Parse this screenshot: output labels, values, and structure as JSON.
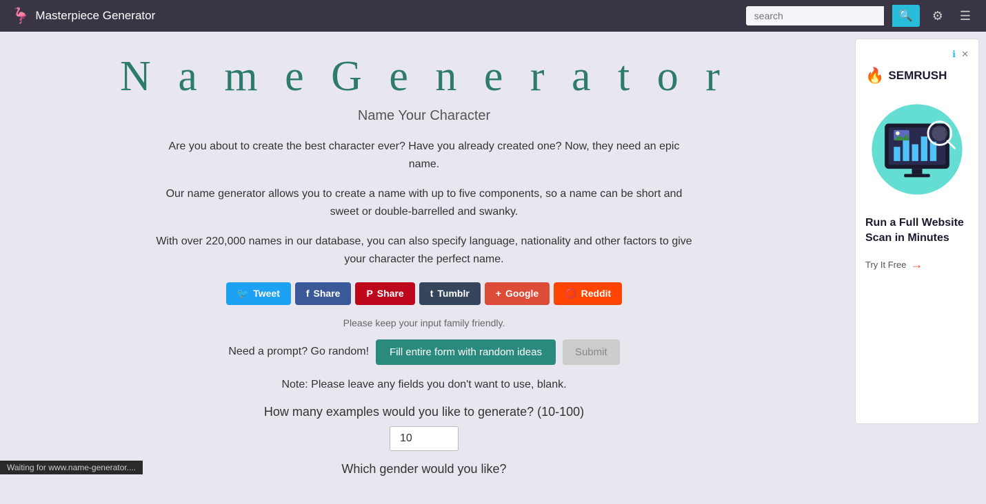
{
  "navbar": {
    "logo_icon": "🦩",
    "title": "Masterpiece Generator",
    "search_placeholder": "search",
    "search_icon": "🔍",
    "tune_icon": "⚙",
    "menu_icon": "☰"
  },
  "page": {
    "title": "N a m e   G e n e r a t o r",
    "subtitle": "Name Your Character",
    "description1": "Are you about to create the best character ever? Have you already created one? Now, they need an epic name.",
    "description2": "Our name generator allows you to create a name with up to five components, so a name can be short and sweet or double-barrelled and swanky.",
    "description3": "With over 220,000 names in our database, you can also specify language, nationality and other factors to give your character the perfect name.",
    "family_friendly": "Please keep your input family friendly.",
    "prompt_label": "Need a prompt? Go random!",
    "fill_random_label": "Fill entire form with random ideas",
    "submit_label": "Submit",
    "blank_note": "Note: Please leave any fields you don't want to use, blank.",
    "examples_question": "How many examples would you like to generate? (10-100)",
    "examples_value": "10",
    "gender_question": "Which gender would you like?"
  },
  "social": {
    "tweet": "Tweet",
    "facebook_share": "Share",
    "pinterest_share": "Share",
    "tumblr": "Tumblr",
    "google": "Google",
    "reddit": "Reddit"
  },
  "ad": {
    "headline": "Run a Full Website Scan in Minutes",
    "cta": "Try It Free",
    "brand": "SEMRUSH"
  },
  "status": {
    "text": "Waiting for www.name-generator...."
  }
}
